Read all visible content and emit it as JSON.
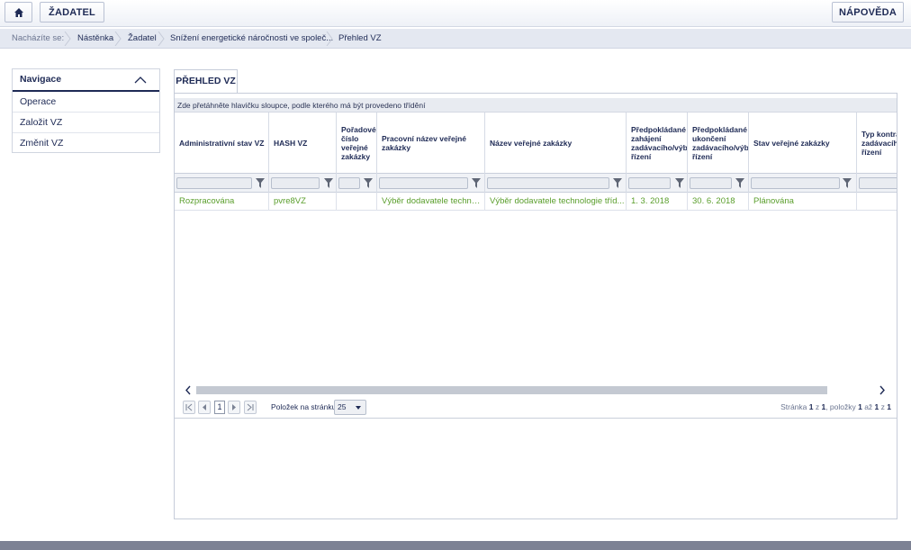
{
  "topbar": {
    "home_icon": "home-icon",
    "zadatel_label": "ŽADATEL",
    "help_label": "NÁPOVĚDA"
  },
  "breadcrumb": {
    "label": "Nacházíte se:",
    "items": [
      "Nástěnka",
      "Žadatel",
      "Snížení energetické náročnosti ve společ...",
      "Přehled VZ"
    ]
  },
  "nav": {
    "title": "Navigace",
    "items": [
      "Operace",
      "Založit VZ",
      "Změnit VZ"
    ]
  },
  "tab": {
    "label": "PŘEHLED VZ"
  },
  "grid": {
    "group_hint": "Zde přetáhněte hlavičku sloupce, podle kterého má být provedeno třídění",
    "columns": [
      "Administrativní stav VZ",
      "HASH VZ",
      "Pořadové číslo veřejné zakázky",
      "Pracovní název veřejné zakázky",
      "Název veřejné zakázky",
      "Předpokládané datum zahájení zadávacího/výběrového řízení",
      "Předpokládané datum ukončení zadávacího/výběrového řízení",
      "Stav veřejné zakázky",
      "Typ kontraktu zadávacího řízení"
    ],
    "rows": [
      [
        "Rozpracována",
        "pvre8VZ",
        "",
        "Výběr dodavatele technologie tříd...",
        "Výběr dodavatele technologie tříd...",
        "1. 3. 2018",
        "30. 6. 2018",
        "Plánována",
        ""
      ]
    ]
  },
  "pager": {
    "current_page": "1",
    "per_page_label": "Položek na stránku",
    "per_page_value": "25",
    "info_prefix": "Stránka ",
    "info_page": "1",
    "info_mid1": " z ",
    "info_pages": "1",
    "info_mid2": ", položky ",
    "info_from": "1",
    "info_mid3": " až ",
    "info_to": "1",
    "info_mid4": " z ",
    "info_total": "1"
  },
  "colors": {
    "text_primary": "#1e2a55",
    "row_text": "#5a9e2c",
    "breadcrumb_bg": "#e4e8f1"
  }
}
